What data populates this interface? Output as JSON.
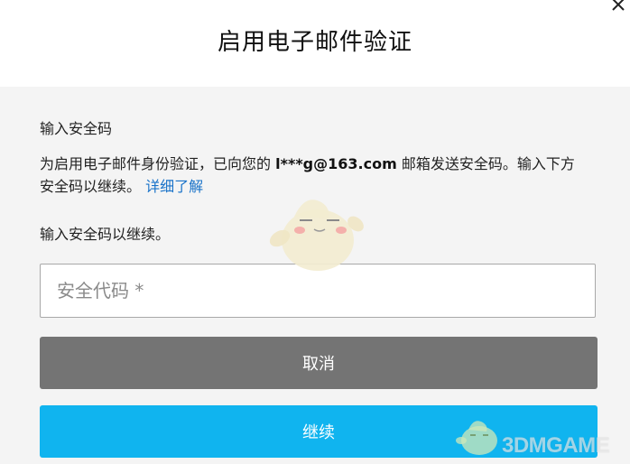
{
  "dialog": {
    "title": "启用电子邮件验证",
    "close_symbol": "✕"
  },
  "form": {
    "label_top": "输入安全码",
    "desc_prefix": "为启用电子邮件身份验证，已向您的 ",
    "email": "l***g@163.com",
    "desc_suffix": " 邮箱发送安全码。输入下方安全码以继续。",
    "learn_more": "详细了解",
    "label_second": "输入安全码以继续。",
    "code_placeholder": "安全代码 *",
    "cancel_label": "取消",
    "continue_label": "继续"
  },
  "watermark": {
    "text": "3DMGAME"
  },
  "colors": {
    "cancel_button": "#747474",
    "continue_button": "#10b4ef",
    "link": "#1a73c9",
    "panel_background": "#f4f4f4"
  },
  "icons": {
    "close": "close-icon",
    "mascot": "mascot-icon"
  }
}
